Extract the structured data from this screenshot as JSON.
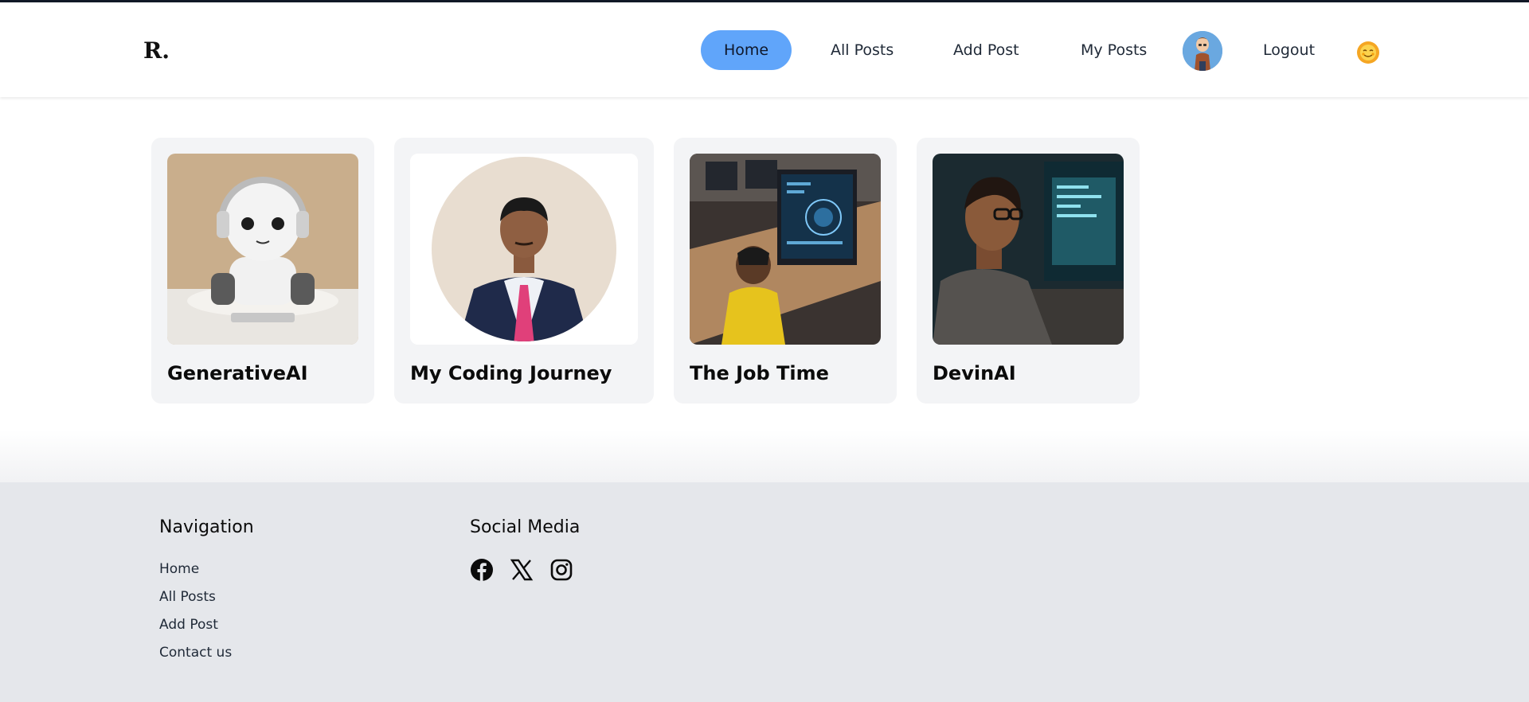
{
  "header": {
    "logo": "R.",
    "nav": {
      "home": "Home",
      "all_posts": "All Posts",
      "add_post": "Add Post",
      "my_posts": "My Posts",
      "logout": "Logout"
    },
    "avatar_icon": "user-avatar-icon",
    "theme_icon": "sun-face-icon"
  },
  "posts": [
    {
      "title": "GenerativeAI",
      "image": "robot-with-headphones-image"
    },
    {
      "title": "My Coding Journey",
      "image": "man-in-suit-portrait-image"
    },
    {
      "title": "The Job Time",
      "image": "child-at-computer-image"
    },
    {
      "title": "DevinAI",
      "image": "man-at-monitors-image"
    }
  ],
  "footer": {
    "navigation_heading": "Navigation",
    "links": [
      "Home",
      "All Posts",
      "Add Post",
      "Contact us"
    ],
    "social_heading": "Social Media",
    "social_icons": [
      "facebook-icon",
      "x-icon",
      "instagram-icon"
    ]
  },
  "colors": {
    "active_nav": "#60a5fa",
    "card_bg": "#f3f4f6",
    "footer_bg": "#e5e7eb"
  }
}
